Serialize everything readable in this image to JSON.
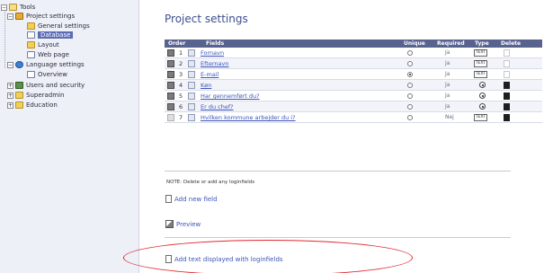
{
  "sidebar": {
    "items": [
      {
        "label": "Tools",
        "level": 0,
        "icon": "folder-open-icon"
      },
      {
        "label": "Project settings",
        "level": 1,
        "icon": "project-icon"
      },
      {
        "label": "General settings",
        "level": 2,
        "icon": "folder-icon"
      },
      {
        "label": "Database",
        "level": 2,
        "icon": "page-icon",
        "selected": true
      },
      {
        "label": "Layout",
        "level": 2,
        "icon": "folder-icon"
      },
      {
        "label": "Web page",
        "level": 2,
        "icon": "page-icon"
      },
      {
        "label": "Language settings",
        "level": 1,
        "icon": "globe-icon"
      },
      {
        "label": "Overview",
        "level": 2,
        "icon": "page-icon"
      },
      {
        "label": "Users and security",
        "level": 1,
        "icon": "users-icon"
      },
      {
        "label": "Superadmin",
        "level": 1,
        "icon": "folder-icon"
      },
      {
        "label": "Education",
        "level": 1,
        "icon": "folder-icon"
      }
    ]
  },
  "page": {
    "title": "Project settings"
  },
  "table": {
    "headers": {
      "order": "Order",
      "fields": "Fields",
      "unique": "Unique",
      "required": "Required",
      "type": "Type",
      "delete": "Delete"
    },
    "rows": [
      {
        "num": "1",
        "name": "Fornavn",
        "unique": false,
        "required": "Ja",
        "type": "TEXT",
        "type_kind": "box",
        "deletable": false
      },
      {
        "num": "2",
        "name": "Efternavn",
        "unique": false,
        "required": "Ja",
        "type": "TEXT",
        "type_kind": "box",
        "deletable": false
      },
      {
        "num": "3",
        "name": "E-mail",
        "unique": true,
        "required": "Ja",
        "type": "TEXT",
        "type_kind": "box",
        "deletable": false
      },
      {
        "num": "4",
        "name": "Køn",
        "unique": false,
        "required": "Ja",
        "type": "",
        "type_kind": "radio",
        "deletable": true
      },
      {
        "num": "5",
        "name": "Har gennemført du?",
        "unique": false,
        "required": "Ja",
        "type": "",
        "type_kind": "radio",
        "deletable": true
      },
      {
        "num": "6",
        "name": "Er du chef?",
        "unique": false,
        "required": "Ja",
        "type": "",
        "type_kind": "radio",
        "deletable": true
      },
      {
        "num": "7",
        "name": "Hvilken kommune arbejder du i?",
        "unique": false,
        "required": "Nej",
        "type": "TEXT",
        "type_kind": "box",
        "deletable": true
      }
    ]
  },
  "note": "NOTE: Delete or add any loginfields",
  "actions": {
    "add_field": "Add new field",
    "preview": "Preview",
    "add_text": "Add text displayed with loginfields"
  },
  "colors": {
    "header_bg": "#58628f",
    "link": "#3c55b8",
    "title": "#3e4d8f",
    "highlight": "#e0282f"
  }
}
